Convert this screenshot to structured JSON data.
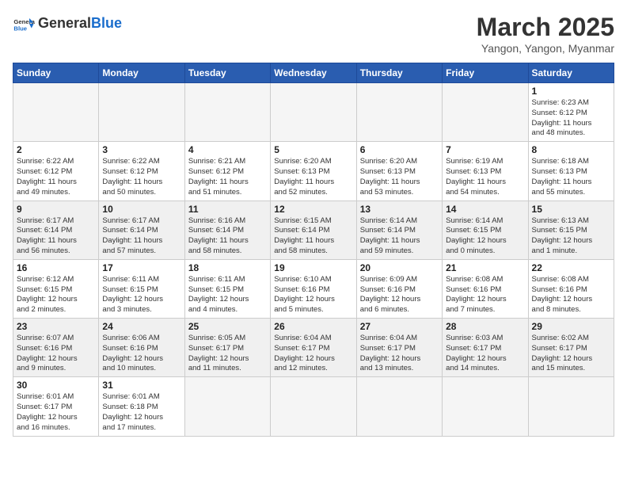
{
  "header": {
    "logo_general": "General",
    "logo_blue": "Blue",
    "month_title": "March 2025",
    "location": "Yangon, Yangon, Myanmar"
  },
  "weekdays": [
    "Sunday",
    "Monday",
    "Tuesday",
    "Wednesday",
    "Thursday",
    "Friday",
    "Saturday"
  ],
  "days": [
    {
      "num": "",
      "info": ""
    },
    {
      "num": "",
      "info": ""
    },
    {
      "num": "",
      "info": ""
    },
    {
      "num": "",
      "info": ""
    },
    {
      "num": "",
      "info": ""
    },
    {
      "num": "",
      "info": ""
    },
    {
      "num": "1",
      "info": "Sunrise: 6:23 AM\nSunset: 6:12 PM\nDaylight: 11 hours\nand 48 minutes."
    },
    {
      "num": "2",
      "info": "Sunrise: 6:22 AM\nSunset: 6:12 PM\nDaylight: 11 hours\nand 49 minutes."
    },
    {
      "num": "3",
      "info": "Sunrise: 6:22 AM\nSunset: 6:12 PM\nDaylight: 11 hours\nand 50 minutes."
    },
    {
      "num": "4",
      "info": "Sunrise: 6:21 AM\nSunset: 6:12 PM\nDaylight: 11 hours\nand 51 minutes."
    },
    {
      "num": "5",
      "info": "Sunrise: 6:20 AM\nSunset: 6:13 PM\nDaylight: 11 hours\nand 52 minutes."
    },
    {
      "num": "6",
      "info": "Sunrise: 6:20 AM\nSunset: 6:13 PM\nDaylight: 11 hours\nand 53 minutes."
    },
    {
      "num": "7",
      "info": "Sunrise: 6:19 AM\nSunset: 6:13 PM\nDaylight: 11 hours\nand 54 minutes."
    },
    {
      "num": "8",
      "info": "Sunrise: 6:18 AM\nSunset: 6:13 PM\nDaylight: 11 hours\nand 55 minutes."
    },
    {
      "num": "9",
      "info": "Sunrise: 6:17 AM\nSunset: 6:14 PM\nDaylight: 11 hours\nand 56 minutes."
    },
    {
      "num": "10",
      "info": "Sunrise: 6:17 AM\nSunset: 6:14 PM\nDaylight: 11 hours\nand 57 minutes."
    },
    {
      "num": "11",
      "info": "Sunrise: 6:16 AM\nSunset: 6:14 PM\nDaylight: 11 hours\nand 58 minutes."
    },
    {
      "num": "12",
      "info": "Sunrise: 6:15 AM\nSunset: 6:14 PM\nDaylight: 11 hours\nand 58 minutes."
    },
    {
      "num": "13",
      "info": "Sunrise: 6:14 AM\nSunset: 6:14 PM\nDaylight: 11 hours\nand 59 minutes."
    },
    {
      "num": "14",
      "info": "Sunrise: 6:14 AM\nSunset: 6:15 PM\nDaylight: 12 hours\nand 0 minutes."
    },
    {
      "num": "15",
      "info": "Sunrise: 6:13 AM\nSunset: 6:15 PM\nDaylight: 12 hours\nand 1 minute."
    },
    {
      "num": "16",
      "info": "Sunrise: 6:12 AM\nSunset: 6:15 PM\nDaylight: 12 hours\nand 2 minutes."
    },
    {
      "num": "17",
      "info": "Sunrise: 6:11 AM\nSunset: 6:15 PM\nDaylight: 12 hours\nand 3 minutes."
    },
    {
      "num": "18",
      "info": "Sunrise: 6:11 AM\nSunset: 6:15 PM\nDaylight: 12 hours\nand 4 minutes."
    },
    {
      "num": "19",
      "info": "Sunrise: 6:10 AM\nSunset: 6:16 PM\nDaylight: 12 hours\nand 5 minutes."
    },
    {
      "num": "20",
      "info": "Sunrise: 6:09 AM\nSunset: 6:16 PM\nDaylight: 12 hours\nand 6 minutes."
    },
    {
      "num": "21",
      "info": "Sunrise: 6:08 AM\nSunset: 6:16 PM\nDaylight: 12 hours\nand 7 minutes."
    },
    {
      "num": "22",
      "info": "Sunrise: 6:08 AM\nSunset: 6:16 PM\nDaylight: 12 hours\nand 8 minutes."
    },
    {
      "num": "23",
      "info": "Sunrise: 6:07 AM\nSunset: 6:16 PM\nDaylight: 12 hours\nand 9 minutes."
    },
    {
      "num": "24",
      "info": "Sunrise: 6:06 AM\nSunset: 6:16 PM\nDaylight: 12 hours\nand 10 minutes."
    },
    {
      "num": "25",
      "info": "Sunrise: 6:05 AM\nSunset: 6:17 PM\nDaylight: 12 hours\nand 11 minutes."
    },
    {
      "num": "26",
      "info": "Sunrise: 6:04 AM\nSunset: 6:17 PM\nDaylight: 12 hours\nand 12 minutes."
    },
    {
      "num": "27",
      "info": "Sunrise: 6:04 AM\nSunset: 6:17 PM\nDaylight: 12 hours\nand 13 minutes."
    },
    {
      "num": "28",
      "info": "Sunrise: 6:03 AM\nSunset: 6:17 PM\nDaylight: 12 hours\nand 14 minutes."
    },
    {
      "num": "29",
      "info": "Sunrise: 6:02 AM\nSunset: 6:17 PM\nDaylight: 12 hours\nand 15 minutes."
    },
    {
      "num": "30",
      "info": "Sunrise: 6:01 AM\nSunset: 6:17 PM\nDaylight: 12 hours\nand 16 minutes."
    },
    {
      "num": "31",
      "info": "Sunrise: 6:01 AM\nSunset: 6:18 PM\nDaylight: 12 hours\nand 17 minutes."
    },
    {
      "num": "",
      "info": ""
    },
    {
      "num": "",
      "info": ""
    },
    {
      "num": "",
      "info": ""
    },
    {
      "num": "",
      "info": ""
    },
    {
      "num": "",
      "info": ""
    }
  ]
}
